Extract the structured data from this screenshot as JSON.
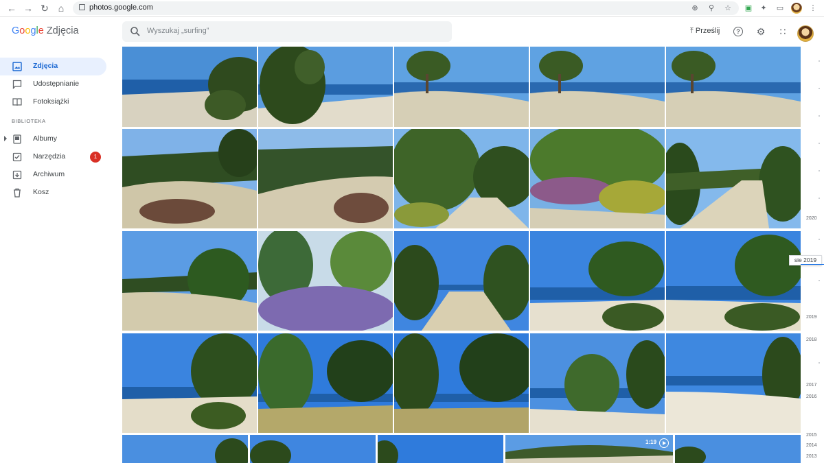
{
  "browser": {
    "url": "photos.google.com"
  },
  "header": {
    "logo_google": "Google",
    "product_name": "Zdjęcia",
    "search_placeholder": "Wyszukaj „surfing”",
    "upload_label": "Prześlij"
  },
  "sidebar": {
    "items": [
      {
        "label": "Zdjęcia",
        "icon": "photo-icon",
        "active": true
      },
      {
        "label": "Udostępnianie",
        "icon": "chat-bubble-icon",
        "active": false
      },
      {
        "label": "Fotoksiążki",
        "icon": "book-icon",
        "active": false
      }
    ],
    "section_label": "BIBLIOTEKA",
    "library_items": [
      {
        "label": "Albumy",
        "icon": "album-icon"
      },
      {
        "label": "Narzędzia",
        "icon": "tools-icon",
        "badge": "1"
      },
      {
        "label": "Archiwum",
        "icon": "archive-icon"
      },
      {
        "label": "Kosz",
        "icon": "trash-icon"
      }
    ]
  },
  "grid": {
    "video_duration": "1:19"
  },
  "timeline": {
    "current": "sie 2019",
    "years": [
      "2020",
      "2019",
      "2018",
      "2017",
      "2016",
      "2015",
      "2014",
      "2013"
    ]
  },
  "colors": {
    "accent": "#1a73e8",
    "active_bg": "#e8f0fe",
    "badge": "#d93025"
  }
}
